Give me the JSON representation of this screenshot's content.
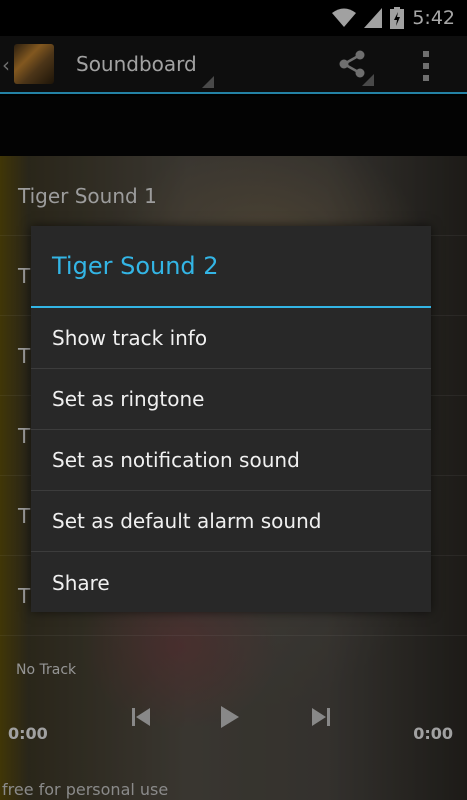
{
  "status_bar": {
    "time": "5:42"
  },
  "action_bar": {
    "title": "Soundboard",
    "back_glyph": "‹"
  },
  "list": {
    "items": [
      "Tiger Sound 1",
      "T",
      "T",
      "T",
      "T",
      "T"
    ]
  },
  "player": {
    "status": "No Track",
    "elapsed": "0:00",
    "duration": "0:00",
    "footer": "free for personal use"
  },
  "dialog": {
    "title": "Tiger Sound 2",
    "items": [
      "Show track info",
      "Set as ringtone",
      "Set as notification sound",
      "Set as default alarm sound",
      "Share"
    ]
  },
  "colors": {
    "accent": "#33b5e5",
    "dialog_bg": "#282828"
  }
}
